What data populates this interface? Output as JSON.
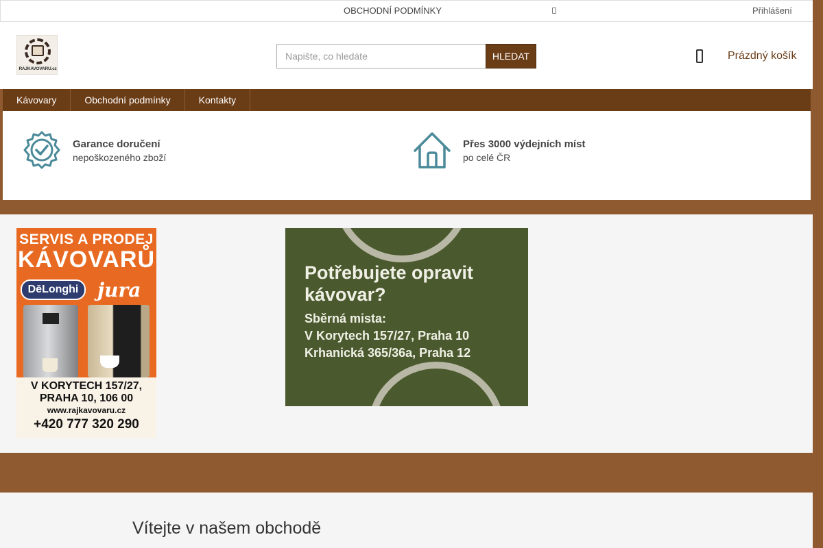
{
  "topbar": {
    "terms_link": "OBCHODNÍ PODMÍNKY",
    "login_link": "Přihlášení"
  },
  "header": {
    "logo_text": "RAJKAVOVARU.cz",
    "search": {
      "placeholder": "Napište, co hledáte",
      "value": "",
      "button_label": "HLEDAT"
    },
    "cart": {
      "icon": "cart-icon",
      "label": "Prázdný košík"
    }
  },
  "nav": {
    "items": [
      {
        "label": "Kávovary"
      },
      {
        "label": "Obchodní podmínky"
      },
      {
        "label": "Kontakty"
      }
    ]
  },
  "benefits": [
    {
      "icon": "badge-check-icon",
      "title": "Garance doručení",
      "subtitle": "nepoškozeného zboží"
    },
    {
      "icon": "house-icon",
      "title": "Přes 3000 výdejních míst",
      "subtitle": "po celé ČR"
    }
  ],
  "banners": {
    "left": {
      "line1": "SERVIS A PRODEJ",
      "line2": "KÁVOVARŮ",
      "brand1": "DēLonghi",
      "brand2": "jura",
      "address1": "V KORYTECH 157/27,",
      "address2": "PRAHA 10, 106 00",
      "web": "www.rajkavovaru.cz",
      "phone": "+420 777 320 290"
    },
    "right": {
      "title1": "Potřebujete opravit",
      "title2": "kávovar?",
      "line1": "Sběrná mista:",
      "line2": "V Korytech 157/27, Praha 10",
      "line3": "Krhanická 365/36a, Praha 12"
    }
  },
  "welcome": {
    "heading": "Vítejte v našem obchodě"
  },
  "colors": {
    "brand_brown": "#6b3d17",
    "page_brown": "#8f5a30",
    "icon_teal": "#4a8a99"
  }
}
